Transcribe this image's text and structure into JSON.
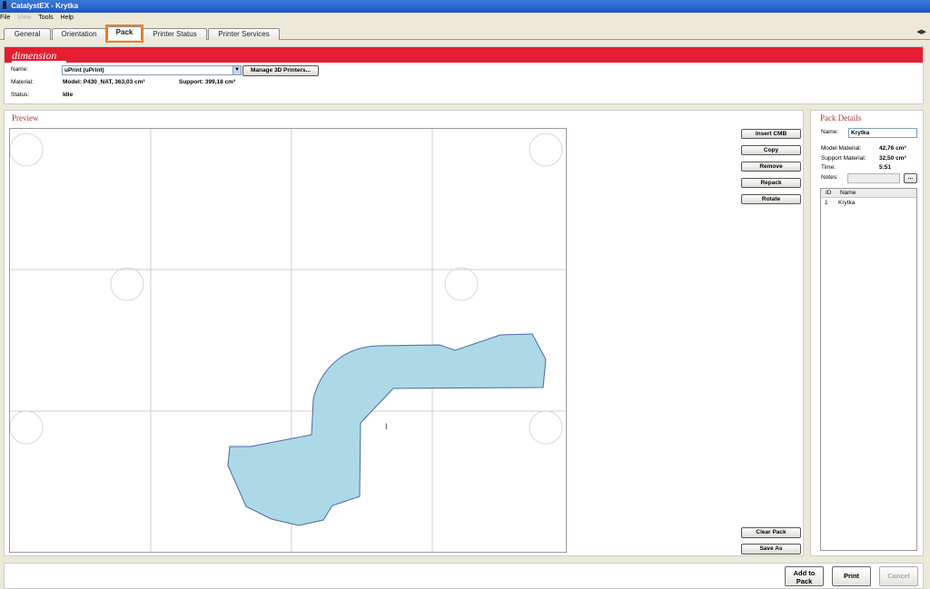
{
  "window": {
    "title": "CatalystEX - Krytka"
  },
  "menu": [
    "File",
    "View",
    "Tools",
    "Help"
  ],
  "tabs": [
    "General",
    "Orientation",
    "Pack",
    "Printer Status",
    "Printer Services"
  ],
  "active_tab": "Pack",
  "brand": {
    "logo": "dimension",
    "color": "#e41e30"
  },
  "printer": {
    "name_label": "Name:",
    "name_value": "uPrint  (uPrint)",
    "manage_button": "Manage 3D Printers...",
    "material_label": "Material:",
    "model_material": "Model: P430_NAT, 363,03 cm³",
    "support_material": "Support: 399,18 cm³",
    "status_label": "Status:",
    "status_value": "Idle"
  },
  "preview": {
    "title": "Preview",
    "cursor_glyph": "I",
    "buttons": {
      "insert_cmb": "Insert CMB",
      "copy": "Copy",
      "remove": "Remove",
      "repack": "Repack",
      "rotate": "Rotate",
      "clear_pack": "Clear Pack",
      "save_as": "Save As"
    },
    "part_fill": "#add8e6"
  },
  "pack_details": {
    "title": "Pack Details",
    "name_label": "Name:",
    "name_value": "Krytka",
    "model_material_label": "Model Material:",
    "model_material_value": "42,76 cm³",
    "support_material_label": "Support Material:",
    "support_material_value": "32,50 cm³",
    "time_label": "Time:",
    "time_value": "5:51",
    "notes_label": "Notes:",
    "notes_button": "...",
    "columns": {
      "id": "ID",
      "name": "Name"
    },
    "rows": [
      {
        "id": "1",
        "name": "Krytka"
      }
    ]
  },
  "footer": {
    "add_to_pack_line1": "Add to",
    "add_to_pack_line2": "Pack",
    "print": "Print",
    "cancel": "Cancel"
  }
}
